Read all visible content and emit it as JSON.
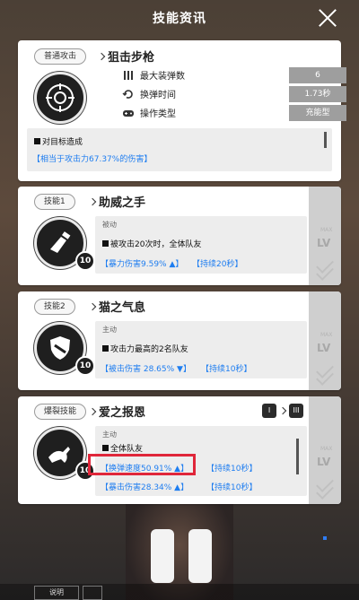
{
  "header": {
    "title": "技能资讯"
  },
  "normal_attack": {
    "tag": "普通攻击",
    "name": "狙击步枪",
    "stats": [
      {
        "icon": "ammo-icon",
        "label": "最大装弹数",
        "value": "6"
      },
      {
        "icon": "reload-icon",
        "label": "换弹时间",
        "value": "1.73秒"
      },
      {
        "icon": "gamepad-icon",
        "label": "操作类型",
        "value": "充能型"
      }
    ],
    "desc_line": "对目标造成",
    "desc_effect": "【相当于攻击力67.37%的伤害】"
  },
  "skills": [
    {
      "tag": "技能1",
      "name": "助威之手",
      "type": "被动",
      "text": "被攻击20次时，全体队友",
      "effects": [
        "【暴力伤害9.59% ▲】",
        "【持续20秒】"
      ],
      "level": "10",
      "lv_label": "LV",
      "max_label": "MAX"
    },
    {
      "tag": "技能2",
      "name": "猫之气息",
      "type": "主动",
      "text": "攻击力最高的2名队友",
      "effects": [
        "【被击伤害 28.65% ▼】",
        "【持续10秒】"
      ],
      "level": "10",
      "lv_label": "LV",
      "max_label": "MAX"
    },
    {
      "tag": "爆裂技能",
      "name": "爱之报恩",
      "type": "主动",
      "text": "全体队友",
      "effects": [
        "【换弹速度50.91% ▲】",
        "【持续10秒】",
        "【暴击伤害28.34% ▲】",
        "【持续10秒】"
      ],
      "level": "10",
      "lv_label": "LV",
      "max_label": "MAX",
      "burst_stages": [
        "I",
        "III"
      ]
    }
  ],
  "bottom": {
    "button": "说明"
  },
  "colors": {
    "accent_blue": "#1e7df0",
    "highlight_red": "#e0263a"
  }
}
